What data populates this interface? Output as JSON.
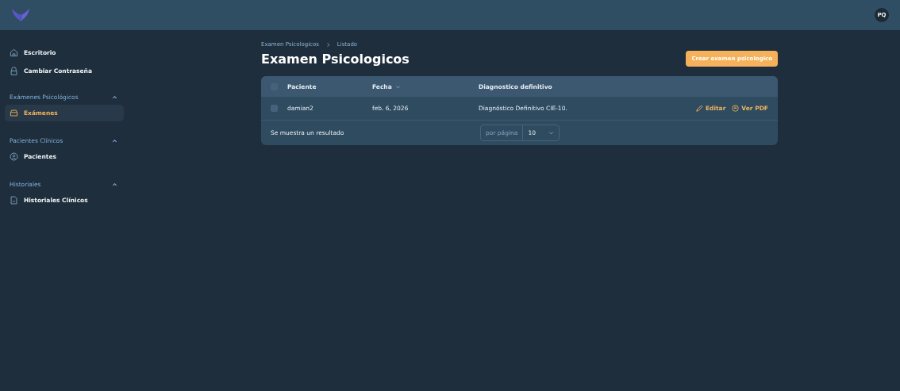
{
  "topbar": {
    "avatar": "PQ"
  },
  "sidebar": {
    "links": [
      {
        "label": "Escritorio",
        "selected": false
      },
      {
        "label": "Cambiar Contraseña",
        "selected": false
      }
    ],
    "groups": [
      {
        "label": "Exámenes Psicológicos",
        "expanded": true,
        "items": [
          {
            "label": "Exámenes",
            "selected": true
          }
        ]
      },
      {
        "label": "Pacientes Clínicos",
        "expanded": true,
        "items": [
          {
            "label": "Pacientes",
            "selected": false
          }
        ]
      },
      {
        "label": "Historiales",
        "expanded": true,
        "items": [
          {
            "label": "Historiales Clínicos",
            "selected": false
          }
        ]
      }
    ]
  },
  "breadcrumbs": [
    "Examen Psicologicos",
    "Listado"
  ],
  "title": "Examen Psicologicos",
  "create_button": "Crear examen psicologico",
  "table": {
    "select_all_checked": false,
    "columns": [
      {
        "label": "Paciente",
        "sortable": false
      },
      {
        "label": "Fecha",
        "sortable": true
      },
      {
        "label": "Diagnostico definitivo",
        "sortable": false
      }
    ],
    "rows": [
      {
        "checked": false,
        "cells": [
          "damian2",
          "feb. 6, 2026",
          "Diagnóstico Definitivo CIE-10."
        ],
        "actions": [
          "Editar",
          "Ver PDF"
        ]
      }
    ],
    "footer": {
      "summary": "Se muestra un resultado",
      "per_page_label": "por página",
      "per_page": "10"
    }
  }
}
